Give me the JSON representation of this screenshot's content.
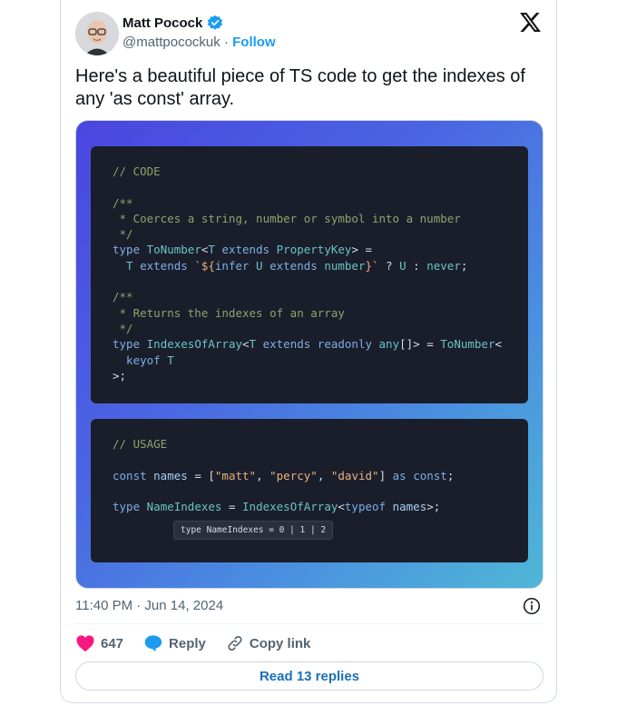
{
  "author": {
    "name": "Matt Pocock",
    "handle": "@mattpocockuk",
    "separator": "·",
    "follow_label": "Follow"
  },
  "tweet": {
    "text": "Here's a beautiful piece of TS code to get the indexes of any 'as const' array."
  },
  "code_block_1": [
    [
      {
        "t": "// CODE",
        "c": "cmt"
      }
    ],
    [],
    [
      {
        "t": "/**",
        "c": "cmt"
      }
    ],
    [
      {
        "t": " * Coerces a string, number or symbol into a number",
        "c": "cmt"
      }
    ],
    [
      {
        "t": " */",
        "c": "cmt"
      }
    ],
    [
      {
        "t": "type ",
        "c": "kw"
      },
      {
        "t": "ToNumber",
        "c": "ty"
      },
      {
        "t": "<",
        "c": "op"
      },
      {
        "t": "T",
        "c": "ty"
      },
      {
        "t": " extends ",
        "c": "kw"
      },
      {
        "t": "PropertyKey",
        "c": "ty"
      },
      {
        "t": "> =",
        "c": "op"
      }
    ],
    [
      {
        "t": "  T",
        "c": "ty"
      },
      {
        "t": " extends ",
        "c": "kw"
      },
      {
        "t": "`${",
        "c": "str"
      },
      {
        "t": "infer ",
        "c": "kw"
      },
      {
        "t": "U",
        "c": "ty"
      },
      {
        "t": " extends ",
        "c": "kw"
      },
      {
        "t": "number",
        "c": "ty"
      },
      {
        "t": "}`",
        "c": "str"
      },
      {
        "t": " ? ",
        "c": "op"
      },
      {
        "t": "U",
        "c": "ty"
      },
      {
        "t": " : ",
        "c": "op"
      },
      {
        "t": "never",
        "c": "ty"
      },
      {
        "t": ";",
        "c": "op"
      }
    ],
    [],
    [
      {
        "t": "/**",
        "c": "cmt"
      }
    ],
    [
      {
        "t": " * Returns the indexes of an array",
        "c": "cmt"
      }
    ],
    [
      {
        "t": " */",
        "c": "cmt"
      }
    ],
    [
      {
        "t": "type ",
        "c": "kw"
      },
      {
        "t": "IndexesOfArray",
        "c": "ty"
      },
      {
        "t": "<",
        "c": "op"
      },
      {
        "t": "T",
        "c": "ty"
      },
      {
        "t": " extends ",
        "c": "kw"
      },
      {
        "t": "readonly ",
        "c": "kw"
      },
      {
        "t": "any",
        "c": "ty"
      },
      {
        "t": "[]> = ",
        "c": "op"
      },
      {
        "t": "ToNumber",
        "c": "ty"
      },
      {
        "t": "<",
        "c": "op"
      }
    ],
    [
      {
        "t": "  keyof ",
        "c": "kw"
      },
      {
        "t": "T",
        "c": "ty"
      }
    ],
    [
      {
        "t": ">;",
        "c": "op"
      }
    ]
  ],
  "code_block_2": [
    [
      {
        "t": "// USAGE",
        "c": "cmt"
      }
    ],
    [],
    [
      {
        "t": "const ",
        "c": "kw"
      },
      {
        "t": "names",
        "c": "var"
      },
      {
        "t": " = [",
        "c": "op"
      },
      {
        "t": "\"matt\"",
        "c": "str"
      },
      {
        "t": ", ",
        "c": "op"
      },
      {
        "t": "\"percy\"",
        "c": "str"
      },
      {
        "t": ", ",
        "c": "op"
      },
      {
        "t": "\"david\"",
        "c": "str"
      },
      {
        "t": "] ",
        "c": "op"
      },
      {
        "t": "as ",
        "c": "kw"
      },
      {
        "t": "const",
        "c": "kw"
      },
      {
        "t": ";",
        "c": "op"
      }
    ],
    [],
    [
      {
        "t": "type ",
        "c": "kw"
      },
      {
        "t": "NameIndexes",
        "c": "ty"
      },
      {
        "t": " = ",
        "c": "op"
      },
      {
        "t": "IndexesOfArray",
        "c": "ty"
      },
      {
        "t": "<",
        "c": "op"
      },
      {
        "t": "typeof ",
        "c": "kw"
      },
      {
        "t": "names",
        "c": "var"
      },
      {
        "t": ">;",
        "c": "op"
      }
    ]
  ],
  "tooltip": {
    "text": "type NameIndexes = 0 | 1 | 2"
  },
  "meta": {
    "timestamp": "11:40 PM · Jun 14, 2024"
  },
  "actions": {
    "like_count": "647",
    "reply_label": "Reply",
    "copy_label": "Copy link"
  },
  "read_replies_label": "Read 13 replies",
  "colors": {
    "accent": "#1d9bf0",
    "like": "#f91880",
    "text": "#0f1419",
    "muted": "#536471"
  }
}
